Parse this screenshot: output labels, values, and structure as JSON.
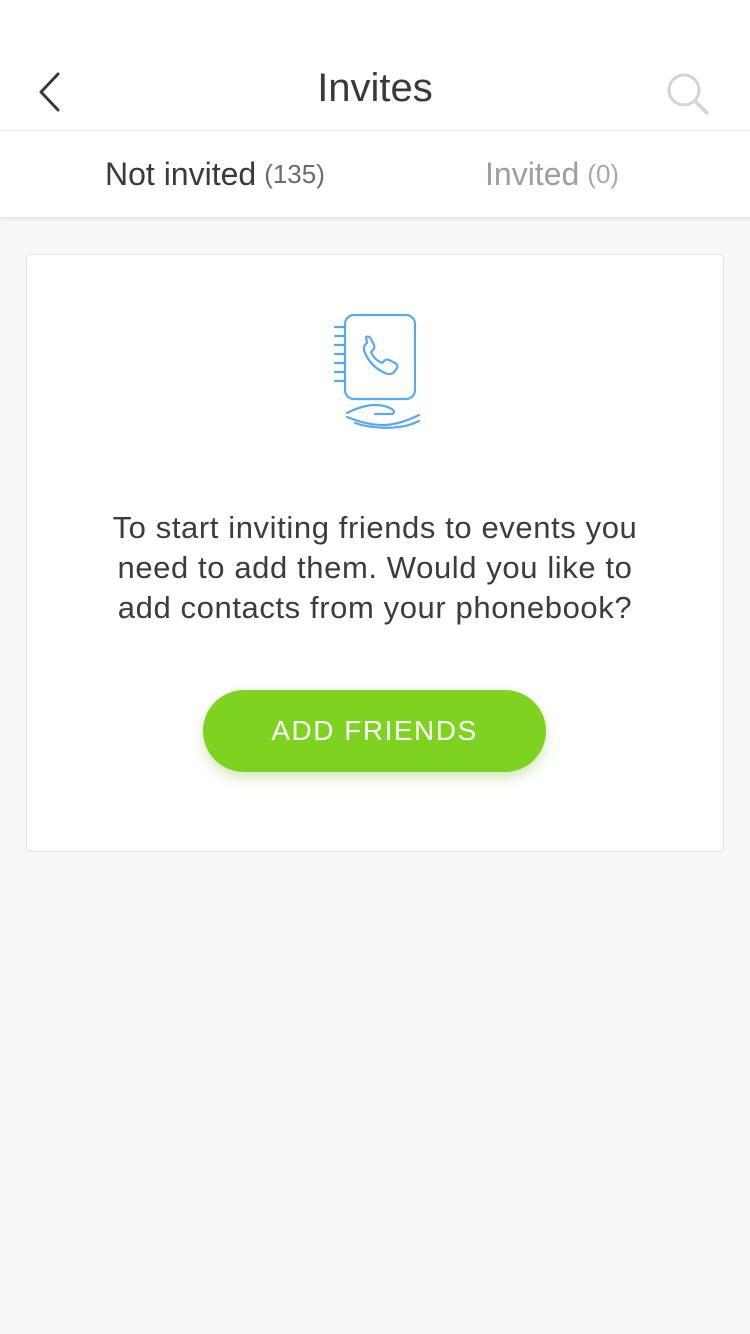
{
  "header": {
    "title": "Invites",
    "back_icon": "chevron-left-icon",
    "search_icon": "search-icon"
  },
  "tabs": [
    {
      "label": "Not invited",
      "count": "(135)",
      "active": true
    },
    {
      "label": "Invited",
      "count": "(0)",
      "active": false
    }
  ],
  "empty_state": {
    "icon": "phonebook-hand-icon",
    "message": "To start inviting friends to events you need to add them. Would you like to add contacts from your phonebook?",
    "button_label": "ADD FRIENDS"
  },
  "colors": {
    "accent": "#7ed321",
    "icon_blue": "#5aa9ee",
    "text_dark": "#3a3a3a",
    "text_muted": "#9e9e9e",
    "background": "#f8f8f8"
  }
}
